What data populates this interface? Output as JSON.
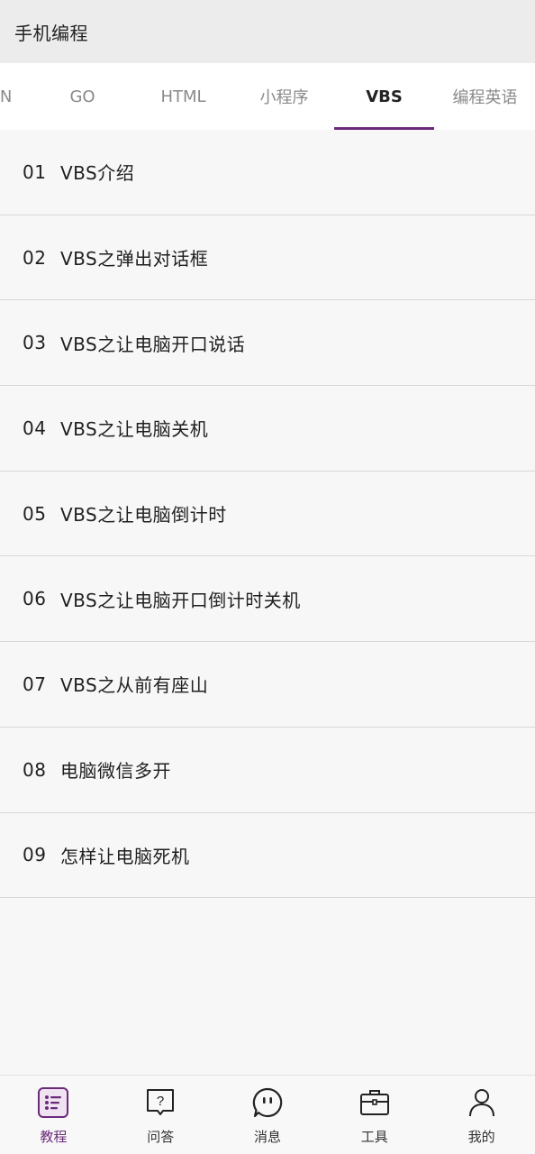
{
  "header": {
    "title": "手机编程"
  },
  "tabs": [
    {
      "label": "ON",
      "active": false
    },
    {
      "label": "GO",
      "active": false
    },
    {
      "label": "HTML",
      "active": false
    },
    {
      "label": "小程序",
      "active": false
    },
    {
      "label": "VBS",
      "active": true
    },
    {
      "label": "编程英语",
      "active": false
    }
  ],
  "list": [
    {
      "num": "01",
      "text": "VBS介绍"
    },
    {
      "num": "02",
      "text": "VBS之弹出对话框"
    },
    {
      "num": "03",
      "text": "VBS之让电脑开口说话"
    },
    {
      "num": "04",
      "text": "VBS之让电脑关机"
    },
    {
      "num": "05",
      "text": "VBS之让电脑倒计时"
    },
    {
      "num": "06",
      "text": "VBS之让电脑开口倒计时关机"
    },
    {
      "num": "07",
      "text": "VBS之从前有座山"
    },
    {
      "num": "08",
      "text": "电脑微信多开"
    },
    {
      "num": "09",
      "text": "怎样让电脑死机"
    }
  ],
  "bottom_nav": [
    {
      "label": "教程",
      "icon": "tutorial-list-icon",
      "active": true
    },
    {
      "label": "问答",
      "icon": "question-bubble-icon",
      "active": false
    },
    {
      "label": "消息",
      "icon": "message-bubble-icon",
      "active": false
    },
    {
      "label": "工具",
      "icon": "toolbox-icon",
      "active": false
    },
    {
      "label": "我的",
      "icon": "user-icon",
      "active": false
    }
  ],
  "colors": {
    "accent": "#6b2a7a",
    "background": "#f7f7f7",
    "header": "#ececec"
  }
}
